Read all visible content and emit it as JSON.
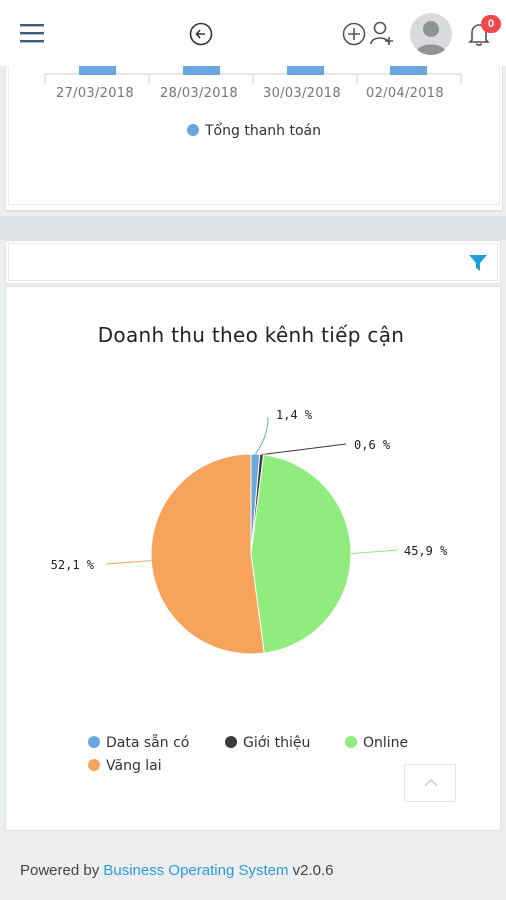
{
  "header": {
    "icons": [
      "menu-icon",
      "back-icon",
      "add-icon",
      "user-icon",
      "avatar",
      "bell-icon"
    ],
    "notification_count": "0"
  },
  "top_chart": {
    "dates": [
      "27/03/2018",
      "28/03/2018",
      "30/03/2018",
      "02/04/2018"
    ],
    "legend_label": "Tổng thanh toán",
    "legend_color": "#6aa6e0"
  },
  "filter_icon": "filter-icon",
  "chart_data": {
    "type": "pie",
    "title": "Doanh thu theo kênh tiếp cận",
    "series": [
      {
        "name": "Data sẵn có",
        "value": 1.4,
        "label": "1,4 %",
        "color": "#6aa6e0"
      },
      {
        "name": "Giới thiệu",
        "value": 0.6,
        "label": "0,6 %",
        "color": "#3a3a3a"
      },
      {
        "name": "Online",
        "value": 45.9,
        "label": "45,9 %",
        "color": "#90ec7d"
      },
      {
        "name": "Vãng lai",
        "value": 52.1,
        "label": "52,1 %",
        "color": "#f7a35c"
      }
    ],
    "legend_position": "bottom"
  },
  "footer": {
    "prefix": "Powered by",
    "link": "Business Operating System",
    "version": "v2.0.6"
  }
}
